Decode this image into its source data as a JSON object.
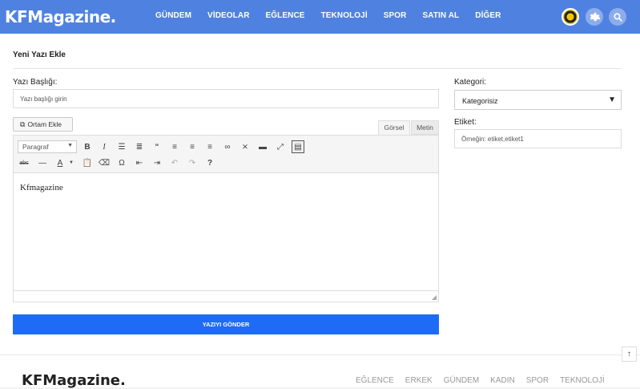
{
  "header": {
    "logo": "KFMagazine.",
    "nav": [
      "GÜNDEM",
      "VİDEOLAR",
      "EĞLENCE",
      "TEKNOLOJİ",
      "SPOR",
      "SATIN AL",
      "DİĞER"
    ],
    "icons": [
      "avatar",
      "gear-icon",
      "search-icon"
    ]
  },
  "form": {
    "title": "Yeni Yazı Ekle",
    "title_label": "Yazı Başlığı:",
    "title_placeholder": "Yazı başlığı girin",
    "category_label": "Kategori:",
    "category_value": "Kategorisiz",
    "tag_label": "Etiket:",
    "tag_placeholder": "Örneğin: etiket,etiket1",
    "media_button": "Ortam Ekle",
    "tabs": [
      "Görsel",
      "Metin"
    ],
    "format_select": "Paragraf",
    "editor_content": "Kfmagazine",
    "submit": "YAZIYI GÖNDER"
  },
  "toolbar_icons": {
    "row1": [
      "bold-icon",
      "italic-icon",
      "bullet-list-icon",
      "numbered-list-icon",
      "blockquote-icon",
      "align-left-icon",
      "align-center-icon",
      "align-right-icon",
      "link-icon",
      "unlink-icon",
      "read-more-icon",
      "fullscreen-icon",
      "toolbar-toggle-icon"
    ],
    "row2": [
      "strikethrough-icon",
      "horizontal-line-icon",
      "text-color-icon",
      "paste-text-icon",
      "clear-format-icon",
      "special-char-icon",
      "outdent-icon",
      "indent-icon",
      "undo-icon",
      "redo-icon",
      "help-icon"
    ]
  },
  "footer": {
    "logo": "KFMagazine.",
    "nav": [
      "EĞLENCE",
      "ERKEK",
      "GÜNDEM",
      "KADIN",
      "SPOR",
      "TEKNOLOJİ"
    ]
  },
  "colors": {
    "header": "#4f82e0",
    "submit": "#1e6cf5"
  }
}
